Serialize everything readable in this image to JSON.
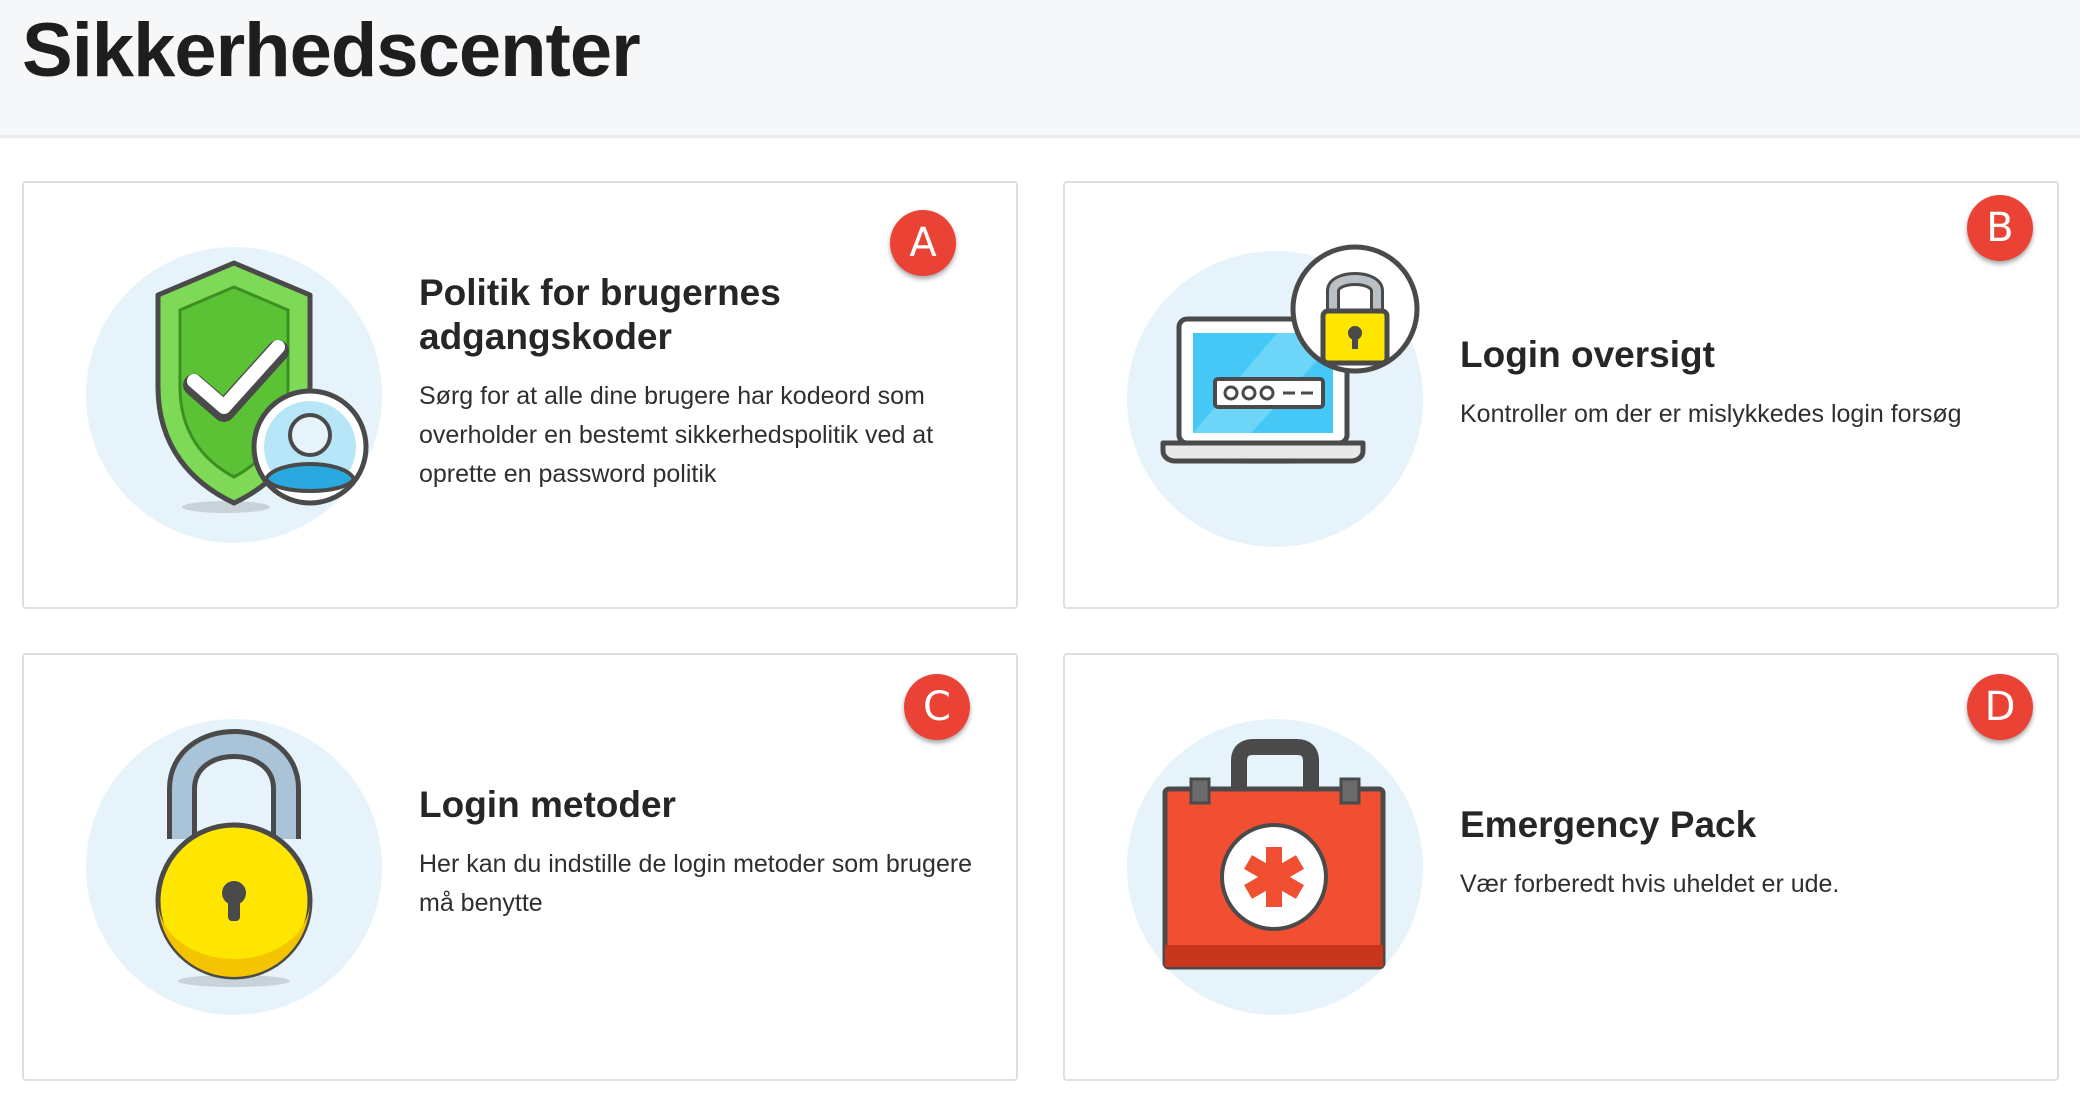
{
  "header": {
    "title": "Sikkerhedscenter"
  },
  "cards": [
    {
      "badge": "A",
      "title": "Politik for brugernes adgangskoder",
      "description": "Sørg for at alle dine brugere har kodeord som overholder en bestemt sikkerhedspolitik ved at oprette en password politik",
      "icon": "shield-user-icon"
    },
    {
      "badge": "B",
      "title": "Login oversigt",
      "description": "Kontroller om der er mislykkedes login forsøg",
      "icon": "laptop-lock-icon"
    },
    {
      "badge": "C",
      "title": "Login metoder",
      "description": "Her kan du indstille de login metoder som brugere må benytte",
      "icon": "padlock-icon"
    },
    {
      "badge": "D",
      "title": "Emergency Pack",
      "description": "Vær forberedt hvis uheldet er ude.",
      "icon": "first-aid-kit-icon"
    }
  ],
  "colors": {
    "badge": "#ea4335",
    "icon_circle": "#e6f3fa",
    "shield_green": "#7ed957",
    "lock_yellow": "#ffe600",
    "kit_red": "#f04f32",
    "screen_blue": "#45c8f5"
  }
}
